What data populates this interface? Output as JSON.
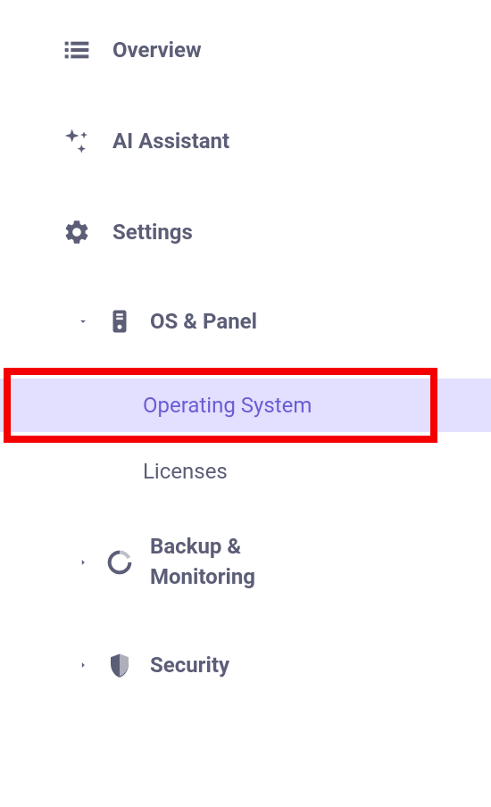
{
  "nav": {
    "overview": "Overview",
    "ai_assistant": "AI Assistant",
    "settings": "Settings",
    "os_panel": "OS & Panel",
    "os_panel_subs": {
      "operating_system": "Operating System",
      "licenses": "Licenses"
    },
    "backup_monitoring_line1": "Backup &",
    "backup_monitoring_line2": "Monitoring",
    "security": "Security"
  }
}
